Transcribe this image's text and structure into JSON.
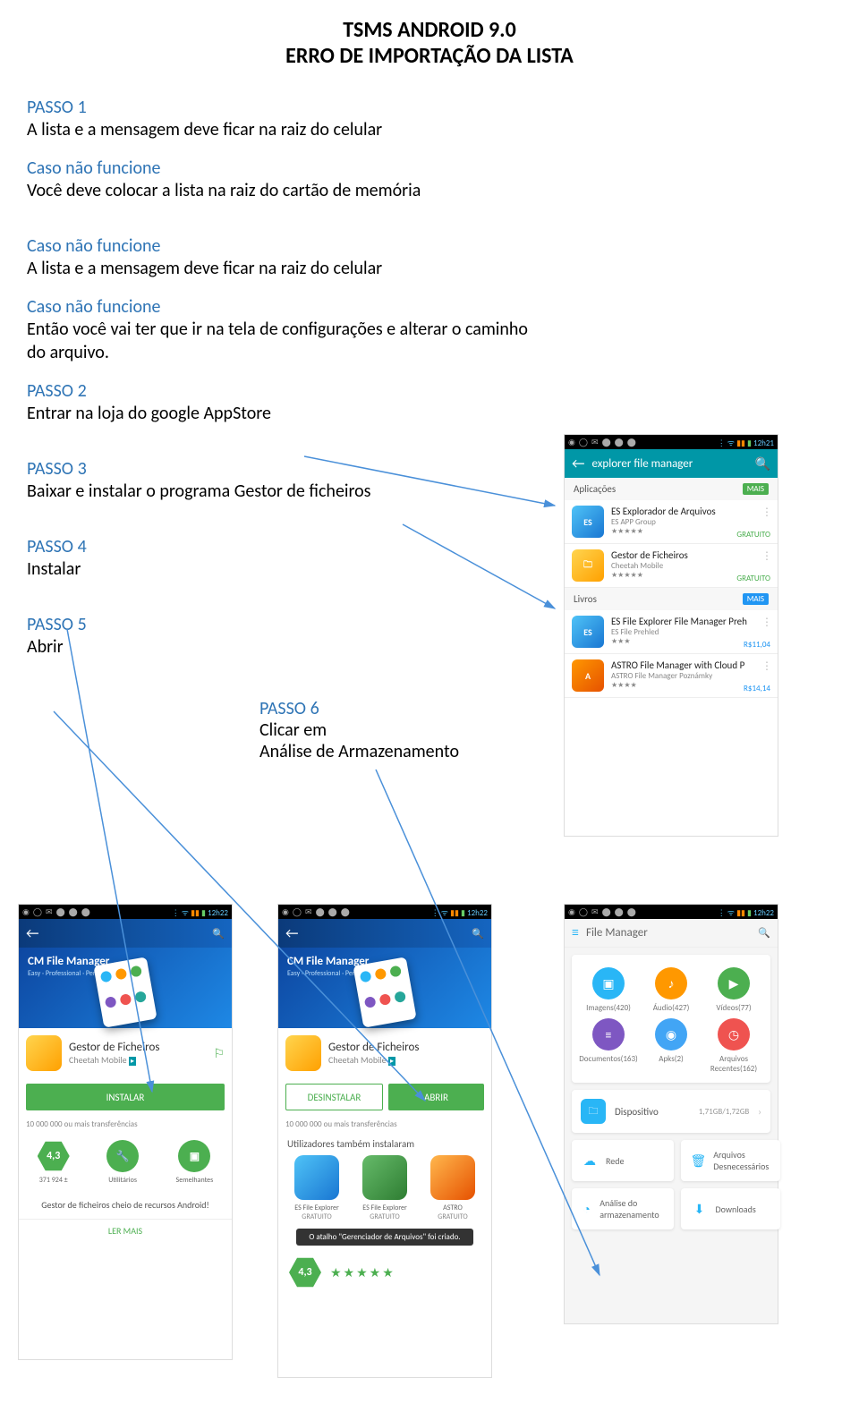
{
  "title_line1": "TSMS ANDROID 9.0",
  "title_line2": "ERRO DE IMPORTAÇÃO DA LISTA",
  "steps": {
    "p1_label": "PASSO 1",
    "p1_text": "A lista e a mensagem deve ficar na raiz do celular",
    "cnf1": "Caso não funcione",
    "cnf1_text": "Você deve colocar a lista na raiz do cartão de memória",
    "cnf2": "Caso não funcione",
    "cnf2_text": "A lista e a mensagem deve ficar na raiz do celular",
    "cnf3": "Caso não funcione",
    "cnf3_text": "Então você vai ter que ir na tela de configurações e alterar o caminho do arquivo.",
    "p2_label": "PASSO 2",
    "p2_text": "Entrar na loja do google AppStore",
    "p3_label": "PASSO 3",
    "p3_text": "Baixar e instalar o programa Gestor de ficheiros",
    "p4_label": "PASSO 4",
    "p4_text": "Instalar",
    "p5_label": "PASSO 5",
    "p5_text": "Abrir",
    "p6_label": "PASSO 6",
    "p6_text1": "Clicar em",
    "p6_text2": "Análise de Armazenamento"
  },
  "playstore": {
    "time": "12h21",
    "search_term": "explorer file manager",
    "section_apps": "Aplicações",
    "section_books": "Livros",
    "mais": "MAIS",
    "apps": [
      {
        "name": "ES Explorador de Arquivos",
        "dev": "ES APP Group",
        "stars": "★★★★★",
        "price": "GRATUITO",
        "icon": "es"
      },
      {
        "name": "Gestor de Ficheiros",
        "dev": "Cheetah Mobile",
        "stars": "★★★★★",
        "price": "GRATUITO",
        "icon": "folder"
      }
    ],
    "books": [
      {
        "name": "ES File Explorer File Manager Preh",
        "dev": "ES File Prehled",
        "stars": "★★★",
        "price": "R$11,04",
        "icon": "es"
      },
      {
        "name": "ASTRO File Manager with Cloud P",
        "dev": "ASTRO File Manager Poznámky",
        "stars": "★★★★",
        "price": "R$14,14",
        "icon": "astro"
      }
    ]
  },
  "detail1": {
    "time": "12h22",
    "hero_title": "CM File Manager",
    "hero_sub": "Easy · Professional · Perfect",
    "app_name": "Gestor de Ficheiros",
    "app_dev": "Cheetah Mobile",
    "btn_install": "INSTALAR",
    "transfers": "10 000 000 ou mais transferências",
    "rating": "4,3",
    "rating_count": "371 924 ±",
    "util": "Utilitários",
    "similar": "Semelhantes",
    "desc": "Gestor de ficheiros cheio de recursos Android!",
    "ler_mais": "LER MAIS"
  },
  "detail2": {
    "hero_title": "CM File Manager",
    "hero_sub": "Easy · Professional · Perfect",
    "app_name": "Gestor de Ficheiros",
    "app_dev": "Cheetah Mobile",
    "btn_uninstall": "DESINSTALAR",
    "btn_open": "ABRIR",
    "transfers": "10 000 000 ou mais transferências",
    "also_title": "Utilizadores também instalaram",
    "also": [
      {
        "name": "ES File Explorer",
        "price": "GRATUITO"
      },
      {
        "name": "ES File Explorer",
        "price": "GRATUITO"
      },
      {
        "name": "ASTRO",
        "price": "GRATUITO"
      }
    ],
    "toast": "O atalho \"Gerenciador de Arquivos\" foi criado.",
    "rating": "4,3"
  },
  "fm": {
    "time": "12h22",
    "title": "File Manager",
    "cats": [
      {
        "label": "Imagens(420)",
        "color": "#29b6f6",
        "icon": "▣"
      },
      {
        "label": "Áudio(427)",
        "color": "#ff9800",
        "icon": "♪"
      },
      {
        "label": "Vídeos(77)",
        "color": "#4caf50",
        "icon": "▶"
      },
      {
        "label": "Documentos(163)",
        "color": "#7e57c2",
        "icon": "≡"
      },
      {
        "label": "Apks(2)",
        "color": "#42a5f5",
        "icon": "◉"
      },
      {
        "label": "Arquivos Recentes(162)",
        "color": "#ef5350",
        "icon": "◷"
      }
    ],
    "device_label": "Dispositivo",
    "device_size": "1,71GB/1,72GB",
    "tiles": [
      {
        "label": "Rede",
        "icon": "☁"
      },
      {
        "label": "Arquivos Desnecessários",
        "icon": "🗑"
      },
      {
        "label": "Análise do armazenamento",
        "icon": "◔"
      },
      {
        "label": "Downloads",
        "icon": "⬇"
      }
    ]
  }
}
